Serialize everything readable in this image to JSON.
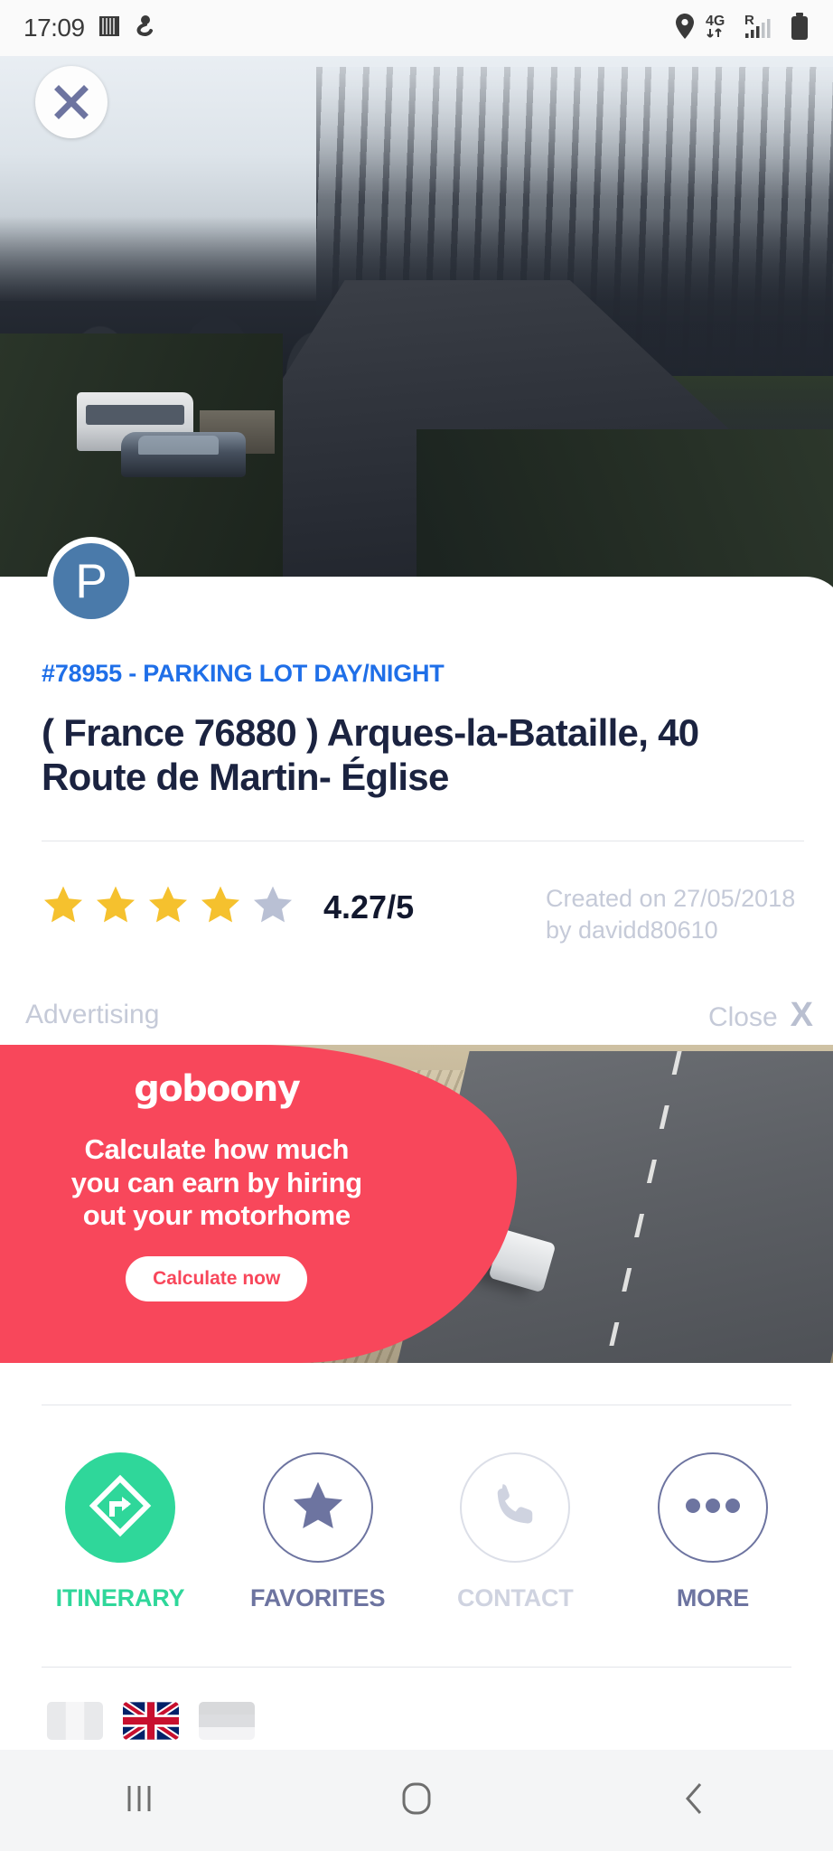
{
  "status_bar": {
    "time": "17:09",
    "left_icons": [
      "calendar-icon",
      "app-icon"
    ],
    "right_icons": [
      "location-pin-icon",
      "4g-data-icon",
      "roaming-signal-icon",
      "battery-icon"
    ],
    "network_label": "4G",
    "roaming_label": "R"
  },
  "hero": {
    "close_icon": "close-icon",
    "carousel": {
      "total_dots": 5,
      "active_index": 0
    },
    "badge_letter": "P"
  },
  "listing": {
    "subtitle": "#78955 - PARKING LOT DAY/NIGHT",
    "title": "( France 76880 ) Arques-la-Bataille, 40 Route de Martin- Église",
    "rating": {
      "stars_filled": 4,
      "stars_total": 5,
      "score": "4.27/5",
      "filled_color": "#f5c12e",
      "empty_color": "#b9c0d4"
    },
    "created": "Created on 27/05/2018 by davidd80610"
  },
  "advertising": {
    "label": "Advertising",
    "close_label": "Close",
    "close_x": "X",
    "brand": "goboony",
    "headline": "Calculate how much you can earn by hiring out your motorhome",
    "cta": "Calculate now",
    "accent_color": "#f8475b"
  },
  "actions": [
    {
      "label": "ITINERARY",
      "icon": "direction-arrow-icon",
      "style": "filled",
      "color": "#2fd79a"
    },
    {
      "label": "FAVORITES",
      "icon": "star-icon",
      "style": "outline",
      "color": "#6d74a0"
    },
    {
      "label": "CONTACT",
      "icon": "phone-icon",
      "style": "outline-light",
      "color": "#cfd3e0"
    },
    {
      "label": "MORE",
      "icon": "ellipsis-icon",
      "style": "outline",
      "color": "#6d74a0"
    }
  ],
  "languages": [
    {
      "name": "french-flag",
      "active": false
    },
    {
      "name": "english-flag",
      "active": true
    },
    {
      "name": "german-flag",
      "active": false
    }
  ],
  "navbar": {
    "recents": "recents-icon",
    "home": "home-icon",
    "back": "back-icon"
  }
}
